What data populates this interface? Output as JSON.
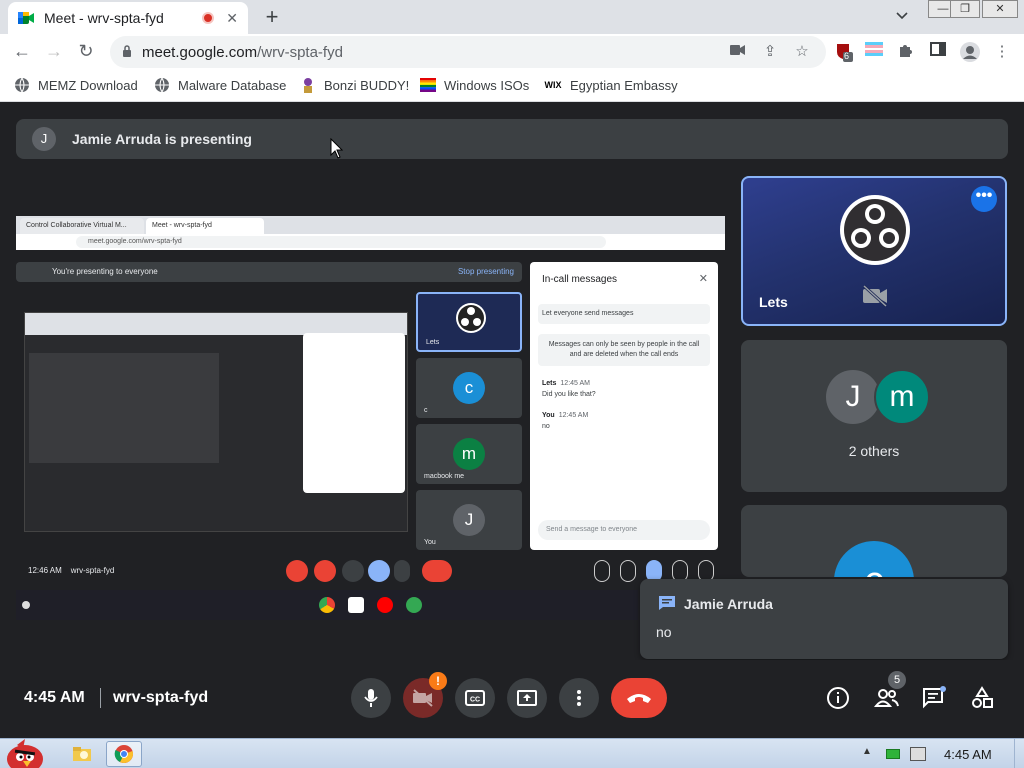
{
  "browser": {
    "tab_title": "Meet - wrv-spta-fyd",
    "new_tab": "+",
    "tab_close": "✕",
    "url_host": "meet.google.com",
    "url_path": "/wrv-spta-fyd",
    "extension_badge": "6",
    "bookmarks": [
      {
        "label": "MEMZ Download"
      },
      {
        "label": "Malware Database"
      },
      {
        "label": "Bonzi BUDDY!"
      },
      {
        "label": "Windows ISOs"
      },
      {
        "label": "Egyptian Embassy",
        "icon_text": "WIX"
      }
    ]
  },
  "meet": {
    "presenter_initial": "J",
    "presenting_text": "Jamie Arruda is presenting",
    "time": "4:45 AM",
    "meeting_code": "wrv-spta-fyd",
    "people_count": "5",
    "warning_badge": "!",
    "tiles": {
      "lets": {
        "name": "Lets",
        "more": "•••"
      },
      "others": {
        "label": "2 others",
        "avatars": [
          "J",
          "m"
        ]
      },
      "partial_avatar": "c"
    },
    "toast": {
      "sender": "Jamie Arruda",
      "message": "no"
    }
  },
  "shared_screen": {
    "tab1": "Control Collaborative Virtual M...",
    "tab2": "Meet - wrv-spta-fyd",
    "url": "meet.google.com/wrv-spta-fyd",
    "presenting_text": "You're presenting to everyone",
    "stop_presenting": "Stop presenting",
    "chat_title": "In-call messages",
    "chat_close": "✕",
    "toggle_label": "Let everyone send messages",
    "chat_note": "Messages can only be seen by people in the call and are deleted when the call ends",
    "messages": [
      {
        "name": "Lets",
        "time": "12:45 AM",
        "text": "Did you like that?"
      },
      {
        "name": "You",
        "time": "12:45 AM",
        "text": "no"
      }
    ],
    "chat_placeholder": "Send a message to everyone",
    "tiles": [
      {
        "label": "Lets",
        "initial": ""
      },
      {
        "label": "c",
        "initial": "c"
      },
      {
        "label": "macbook me",
        "initial": "m"
      },
      {
        "label": "You",
        "initial": "J"
      }
    ],
    "time": "12:46 AM",
    "meeting_code": "wrv-spta-fyd"
  },
  "taskbar": {
    "time": "4:45 AM"
  },
  "colors": {
    "accent": "#8ab4f8",
    "end_call": "#ea4335",
    "meet_bg": "#202124"
  }
}
